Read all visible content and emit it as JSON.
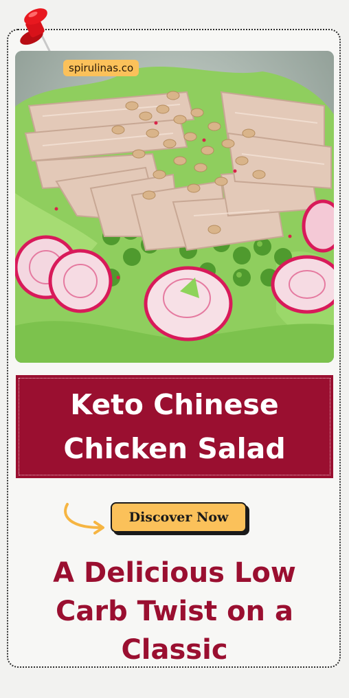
{
  "brand": {
    "label": "spirulinas.co"
  },
  "hero": {
    "title_line1": "Keto Chinese",
    "title_line2": "Chicken Salad"
  },
  "cta": {
    "label": "Discover Now"
  },
  "subtitle": {
    "line1": "A Delicious Low",
    "line2": "Carb Twist on a",
    "line3": "Classic"
  },
  "colors": {
    "accent_red": "#9a0f30",
    "button_yellow": "#fbc15a",
    "page_bg": "#f2f2f0",
    "pin_red": "#e0141c"
  },
  "icons": {
    "pin": "push-pin-icon",
    "arrow": "curved-arrow-icon"
  }
}
